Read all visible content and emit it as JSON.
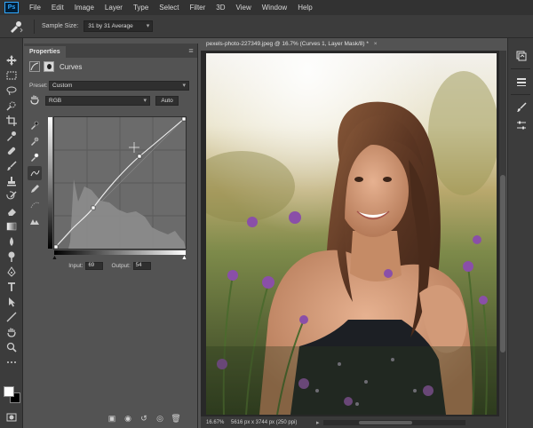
{
  "app": {
    "logo": "Ps"
  },
  "menu": [
    "File",
    "Edit",
    "Image",
    "Layer",
    "Type",
    "Select",
    "Filter",
    "3D",
    "View",
    "Window",
    "Help"
  ],
  "options_bar": {
    "sample_size_label": "Sample Size:",
    "sample_size_value": "31 by 31 Average"
  },
  "properties": {
    "tab_label": "Properties",
    "title": "Curves",
    "preset_label": "Preset:",
    "preset_value": "Custom",
    "channel_value": "RGB",
    "auto_label": "Auto",
    "input_label": "Input:",
    "input_value": "69",
    "output_label": "Output:",
    "output_value": "54"
  },
  "document": {
    "tab_title": "pexels-photo-227349.jpeg @ 16.7% (Curves 1, Layer Mask/8) *",
    "close_glyph": "×",
    "zoom": "16.67%",
    "doc_info": "5616 px x 3744 px (250 ppi)"
  },
  "icons": {
    "tools": [
      "move-icon",
      "marquee-icon",
      "lasso-icon",
      "quick-select-icon",
      "crop-icon",
      "eyedropper-icon",
      "healing-icon",
      "brush-icon",
      "stamp-icon",
      "history-brush-icon",
      "eraser-icon",
      "gradient-icon",
      "blur-icon",
      "dodge-icon",
      "pen-icon",
      "type-icon",
      "path-select-icon",
      "line-icon",
      "hand-icon",
      "zoom-icon",
      "more-icon"
    ],
    "right_dock": [
      "history-icon",
      "libraries-icon",
      "brush-settings-icon",
      "adjust-icon"
    ]
  },
  "colors": {
    "menubar": "#323232",
    "panel": "#535353",
    "foreground": "#ffffff",
    "background": "#000000"
  }
}
